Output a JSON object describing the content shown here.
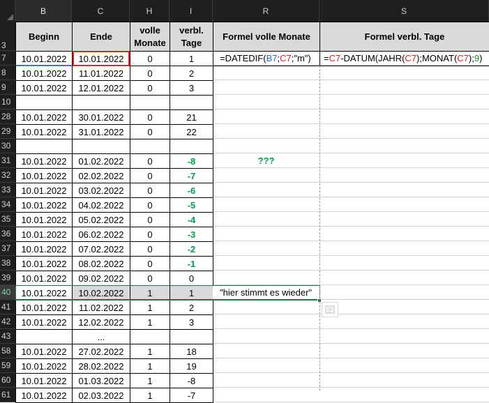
{
  "columns": [
    "B",
    "C",
    "H",
    "I",
    "R",
    "S"
  ],
  "row_numbers": [
    "3",
    "7",
    "8",
    "9",
    "10",
    "28",
    "29",
    "30",
    "31",
    "32",
    "33",
    "34",
    "35",
    "36",
    "37",
    "38",
    "39",
    "40",
    "41",
    "42",
    "43",
    "58",
    "59",
    "60",
    "61"
  ],
  "headers": {
    "beginn": "Beginn",
    "ende": "Ende",
    "volle_1": "volle",
    "volle_2": "Monate",
    "verbl_1": "verbl.",
    "verbl_2": "Tage",
    "formel_monate": "Formel volle Monate",
    "formel_tage": "Formel verbl. Tage"
  },
  "rows": [
    {
      "b": "10.01.2022",
      "c": "10.01.2022",
      "h": "0",
      "i": "1",
      "neg": false
    },
    {
      "b": "10.01.2022",
      "c": "11.01.2022",
      "h": "0",
      "i": "2",
      "neg": false
    },
    {
      "b": "10.01.2022",
      "c": "12.01.2022",
      "h": "0",
      "i": "3",
      "neg": false
    },
    {
      "b": "",
      "c": "",
      "h": "",
      "i": "",
      "neg": false
    },
    {
      "b": "10.01.2022",
      "c": "30.01.2022",
      "h": "0",
      "i": "21",
      "neg": false
    },
    {
      "b": "10.01.2022",
      "c": "31.01.2022",
      "h": "0",
      "i": "22",
      "neg": false
    },
    {
      "b": "",
      "c": "",
      "h": "",
      "i": "",
      "neg": false
    },
    {
      "b": "10.01.2022",
      "c": "01.02.2022",
      "h": "0",
      "i": "-8",
      "neg": true
    },
    {
      "b": "10.01.2022",
      "c": "02.02.2022",
      "h": "0",
      "i": "-7",
      "neg": true
    },
    {
      "b": "10.01.2022",
      "c": "03.02.2022",
      "h": "0",
      "i": "-6",
      "neg": true
    },
    {
      "b": "10.01.2022",
      "c": "04.02.2022",
      "h": "0",
      "i": "-5",
      "neg": true
    },
    {
      "b": "10.01.2022",
      "c": "05.02.2022",
      "h": "0",
      "i": "-4",
      "neg": true
    },
    {
      "b": "10.01.2022",
      "c": "06.02.2022",
      "h": "0",
      "i": "-3",
      "neg": true
    },
    {
      "b": "10.01.2022",
      "c": "07.02.2022",
      "h": "0",
      "i": "-2",
      "neg": true
    },
    {
      "b": "10.01.2022",
      "c": "08.02.2022",
      "h": "0",
      "i": "-1",
      "neg": true
    },
    {
      "b": "10.01.2022",
      "c": "09.02.2022",
      "h": "0",
      "i": "0",
      "neg": false
    },
    {
      "b": "10.01.2022",
      "c": "10.02.2022",
      "h": "1",
      "i": "1",
      "neg": false
    },
    {
      "b": "10.01.2022",
      "c": "11.02.2022",
      "h": "1",
      "i": "2",
      "neg": false
    },
    {
      "b": "10.01.2022",
      "c": "12.02.2022",
      "h": "1",
      "i": "3",
      "neg": false
    },
    {
      "b": "",
      "c": "...",
      "h": "",
      "i": "",
      "neg": false
    },
    {
      "b": "10.01.2022",
      "c": "27.02.2022",
      "h": "1",
      "i": "18",
      "neg": false
    },
    {
      "b": "10.01.2022",
      "c": "28.02.2022",
      "h": "1",
      "i": "19",
      "neg": false
    },
    {
      "b": "10.01.2022",
      "c": "01.03.2022",
      "h": "1",
      "i": "-8",
      "neg": false
    },
    {
      "b": "10.01.2022",
      "c": "02.03.2022",
      "h": "1",
      "i": "-7",
      "neg": false
    }
  ],
  "formula_r": {
    "t1": "=DATEDIF(",
    "t2": "B7",
    "t3": ";",
    "t4": "C7",
    "t5": ";\"m\")"
  },
  "formula_s": {
    "t1": "=",
    "t2": "C7",
    "t3": "-DATUM(JAHR(",
    "t4": "C7",
    "t5": ");MONAT(",
    "t6": "C7",
    "t7": ");",
    "t8": "9",
    "t9": ")"
  },
  "note_questions": "???",
  "note_match": "\"hier stimmt es wieder\"",
  "colors": {
    "header_bg": "#1f1f1f",
    "highlight_border": "#e02020",
    "selection_border": "#217346",
    "negative_text": "#00a04a"
  }
}
